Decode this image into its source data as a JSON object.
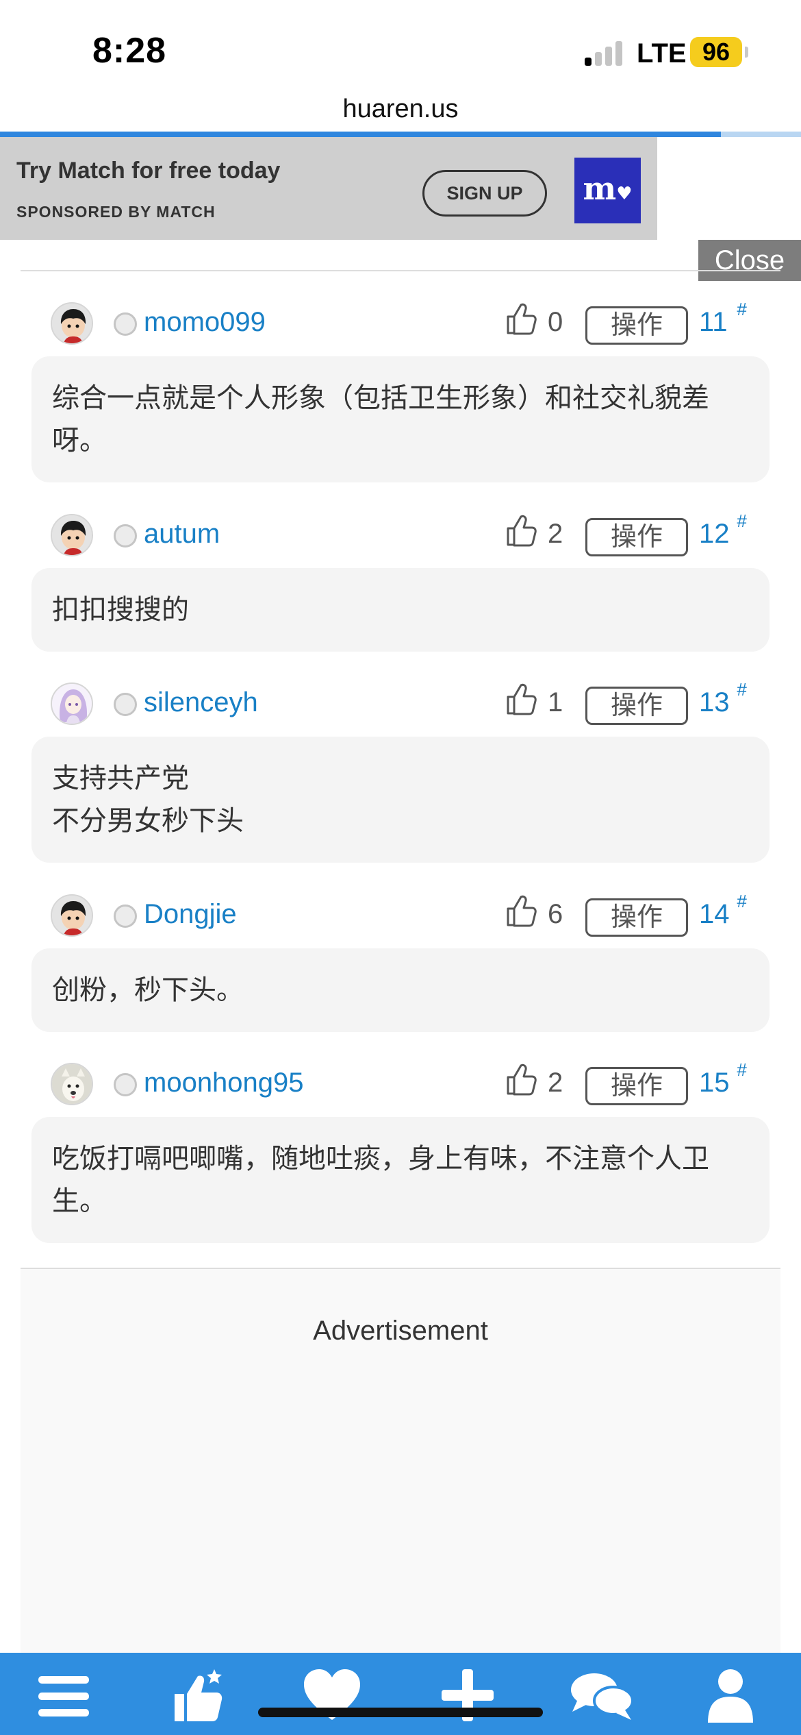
{
  "status_bar": {
    "time": "8:28",
    "network": "LTE",
    "battery": "96"
  },
  "browser": {
    "url": "huaren.us",
    "load_progress": 0.9
  },
  "ad_banner": {
    "title": "Try Match for free today",
    "sponsor": "SPONSORED BY MATCH",
    "cta": "SIGN UP",
    "logo": "m",
    "close": "Close"
  },
  "posts": [
    {
      "username": "momo099",
      "likes": "0",
      "action": "操作",
      "floor": "11",
      "hash": "#",
      "avatar": "boy-avatar",
      "lines": [
        "综合一点就是个人形象（包括卫生形象）和社交礼貌差",
        "呀。"
      ]
    },
    {
      "username": "autum",
      "likes": "2",
      "action": "操作",
      "floor": "12",
      "hash": "#",
      "avatar": "boy-avatar",
      "lines": [
        "扣扣搜搜的"
      ]
    },
    {
      "username": "silenceyh",
      "likes": "1",
      "action": "操作",
      "floor": "13",
      "hash": "#",
      "avatar": "anime-girl-avatar",
      "lines": [
        "支持共产党",
        "不分男女秒下头"
      ]
    },
    {
      "username": "Dongjie",
      "likes": "6",
      "action": "操作",
      "floor": "14",
      "hash": "#",
      "avatar": "boy-avatar",
      "lines": [
        "创粉，秒下头。"
      ]
    },
    {
      "username": "moonhong95",
      "likes": "2",
      "action": "操作",
      "floor": "15",
      "hash": "#",
      "avatar": "dog-avatar",
      "lines": [
        "吃饭打嗝吧唧嘴，随地吐痰，身上有味，不注意个人卫",
        "生。"
      ]
    }
  ],
  "advertisement": {
    "label": "Advertisement"
  },
  "bottom_nav": {
    "items": [
      "menu-icon",
      "thumbs-up-star-icon",
      "heart-icon",
      "plus-icon",
      "chat-icon",
      "user-icon"
    ]
  },
  "colors": {
    "link": "#1980c6",
    "nav_bg": "#2f8ee0",
    "card_bg": "#f4f4f4"
  }
}
